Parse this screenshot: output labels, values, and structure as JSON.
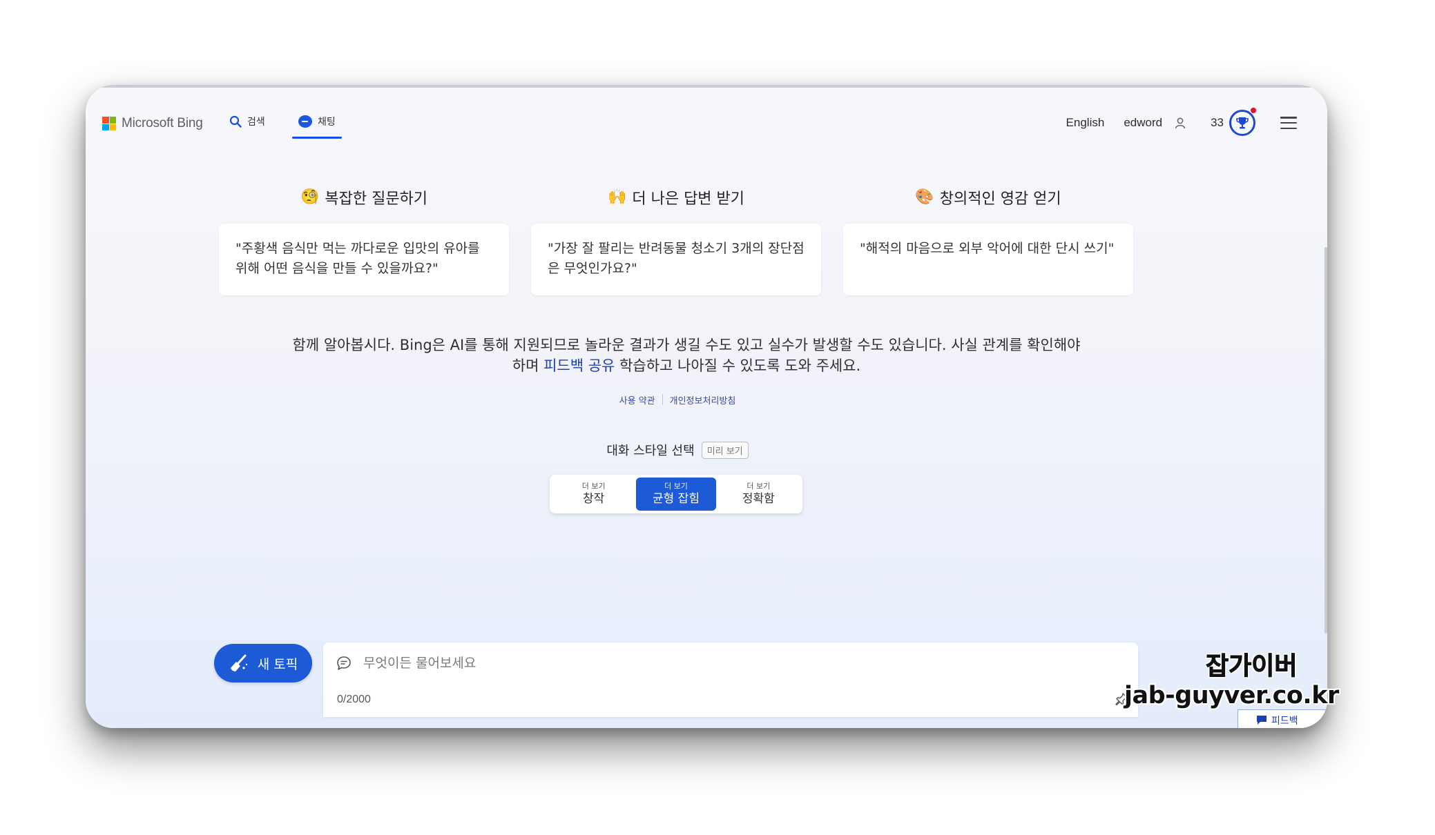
{
  "header": {
    "logo_text": "Microsoft Bing",
    "tabs": [
      {
        "label": "검색",
        "icon": "search-icon"
      },
      {
        "label": "채팅",
        "icon": "chat-icon",
        "active": true
      }
    ],
    "language": "English",
    "username": "edword",
    "points": "33",
    "accent_color": "#174ae4"
  },
  "features": [
    {
      "emoji": "🧐",
      "title": "복잡한 질문하기",
      "example": "\"주황색 음식만 먹는 까다로운 입맛의 유아를 위해 어떤 음식을 만들 수 있을까요?\""
    },
    {
      "emoji": "🙌",
      "title": "더 나은 답변 받기",
      "example": "\"가장 잘 팔리는 반려동물 청소기 3개의 장단점은 무엇인가요?\""
    },
    {
      "emoji": "🎨",
      "title": "창의적인 영감 얻기",
      "example": "\"해적의 마음으로 외부 악어에 대한 단시 쓰기\""
    }
  ],
  "disclaimer": {
    "line1": "함께 알아봅시다. Bing은 AI를 통해 지원되므로 놀라운 결과가 생길 수도 있고 실수가 발생할 수도 있습니다. 사실 관계를 확인해야",
    "line2_pre": "하며 ",
    "feedback_link": "피드백 공유",
    "line2_post": " 학습하고 나아질 수 있도록 도와 주세요."
  },
  "policy_links": [
    "사용 약관",
    "개인정보처리방침"
  ],
  "style_picker": {
    "label": "대화 스타일 선택",
    "preview_badge": "미리 보기",
    "options": [
      {
        "small": "더 보기",
        "label": "창작"
      },
      {
        "small": "더 보기",
        "label": "균형 잡힘",
        "active": true
      },
      {
        "small": "더 보기",
        "label": "정확함"
      }
    ]
  },
  "composer": {
    "new_topic_label": "새 토픽",
    "placeholder": "무엇이든 물어보세요",
    "char_count": "0/2000"
  },
  "feedback_tab": "피드백",
  "watermark": {
    "line1": "잡가이버",
    "line2": "jab-guyver.co.kr"
  }
}
